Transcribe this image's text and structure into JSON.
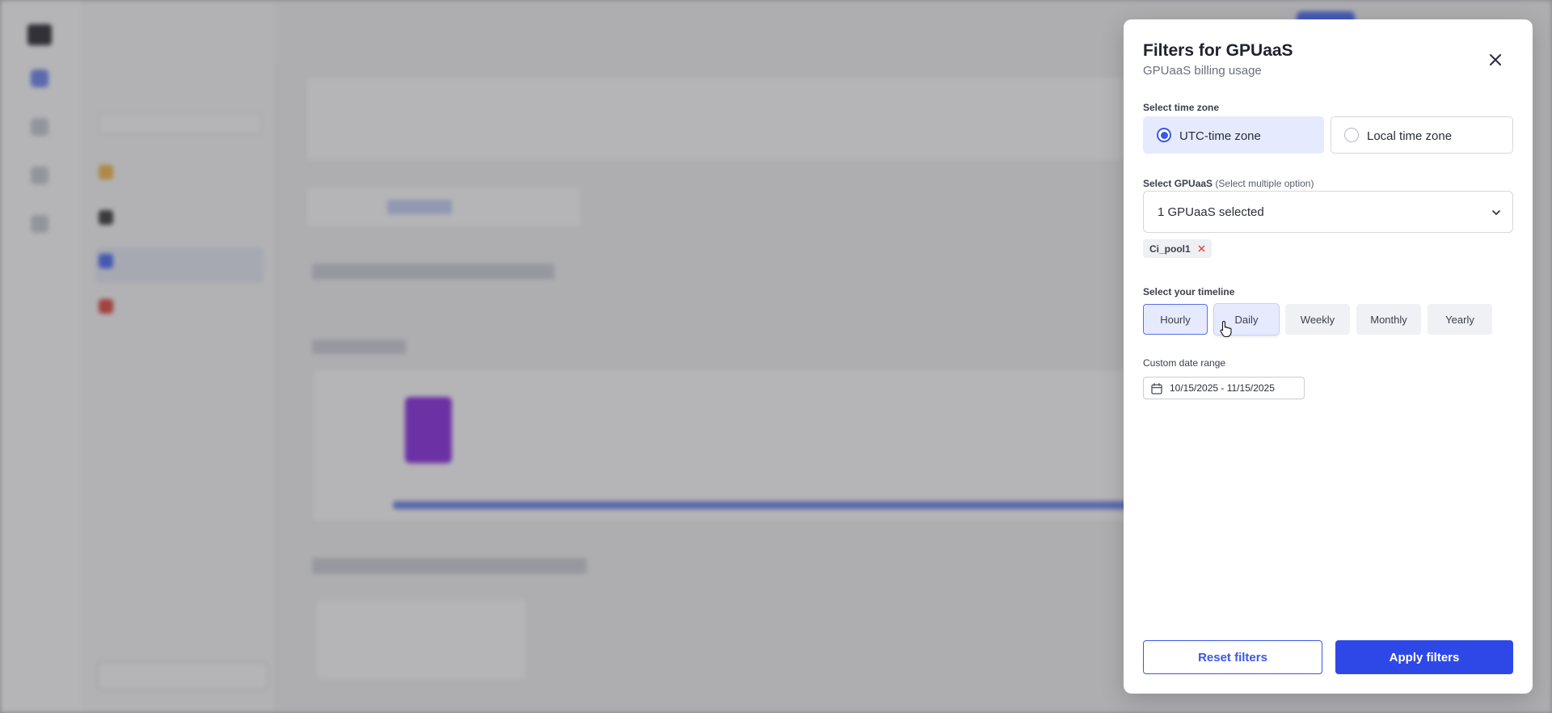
{
  "modal": {
    "title": "Filters for GPUaaS",
    "subtitle": "GPUaaS billing usage",
    "timezone": {
      "label": "Select time zone",
      "options": [
        {
          "label": "UTC-time zone",
          "selected": true
        },
        {
          "label": "Local time zone",
          "selected": false
        }
      ]
    },
    "gpuaas": {
      "label": "Select GPUaaS",
      "hint": "(Select multiple option)",
      "dropdown_value": "1 GPUaaS selected",
      "chips": [
        "Ci_pool1"
      ]
    },
    "timeline": {
      "label": "Select your timeline",
      "options": [
        "Hourly",
        "Daily",
        "Weekly",
        "Monthly",
        "Yearly"
      ],
      "selected": "Hourly"
    },
    "date_range": {
      "label": "Custom date range",
      "value": "10/15/2025 - 11/15/2025"
    },
    "buttons": {
      "reset": "Reset filters",
      "apply": "Apply filters"
    }
  },
  "colors": {
    "accent": "#2e48e8",
    "selected_bg": "#e6eaff",
    "backdrop": "#a9a9ab"
  }
}
